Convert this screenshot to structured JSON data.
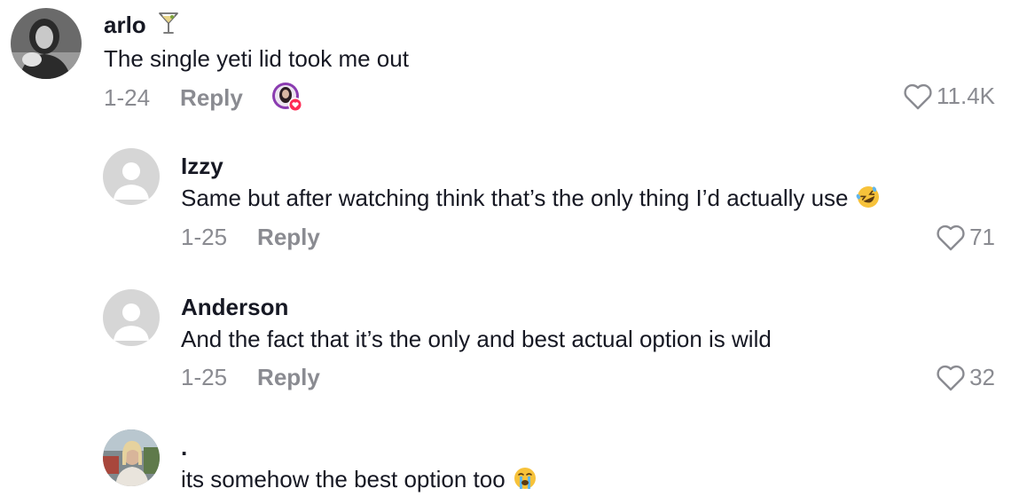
{
  "comments": [
    {
      "username": "arlo",
      "badge": "cocktail-glass-icon",
      "text": "The single yeti lid took me out",
      "date": "1-24",
      "reply_label": "Reply",
      "likes": "11.4K",
      "liked_by_creator": true
    },
    {
      "username": "Izzy",
      "text": "Same but after watching think that’s the only thing I’d actually use",
      "emoji": "rolling-on-floor-laughing-icon",
      "date": "1-25",
      "reply_label": "Reply",
      "likes": "71"
    },
    {
      "username": "Anderson",
      "text": "And the fact that it’s the only and best actual option is wild",
      "date": "1-25",
      "reply_label": "Reply",
      "likes": "32"
    },
    {
      "username": ".",
      "text": "its somehow the best option too",
      "emoji": "loudly-crying-face-icon"
    }
  ],
  "colors": {
    "text_primary": "#161823",
    "text_secondary": "#8a8b91",
    "creator_heart": "#fe2c55"
  }
}
